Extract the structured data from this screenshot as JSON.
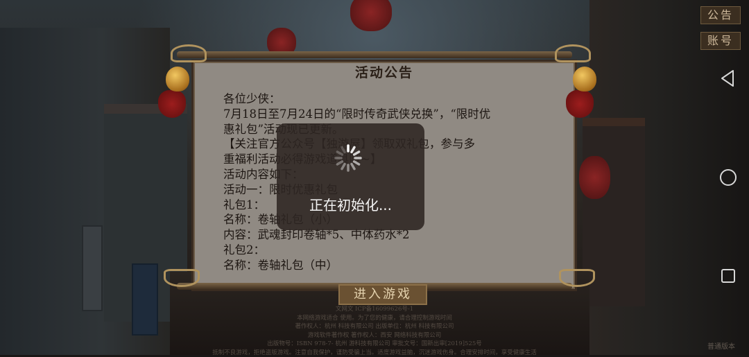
{
  "side_buttons": {
    "notice": "公告",
    "account": "账号"
  },
  "dialog": {
    "title": "活动公告",
    "lines": [
      "各位少侠：",
      "7月18日至7月24日的“限时传奇武侠兑换”，“限时优",
      "惠礼包”活动现已更新。",
      "【关注官方公众号【独游屋】领取双礼包，参与多",
      "重福利活动必得游戏道具哦~】",
      "活动内容如下：",
      "活动一：限时优惠礼包",
      "礼包1：",
      "名称：卷轴礼包（小）",
      "内容：武魂封印卷轴*5、中体药水*2",
      "礼包2：",
      "名称：卷轴礼包（中）"
    ]
  },
  "enter_button": "进入游戏",
  "loading": {
    "text": "正在初始化..."
  },
  "footer": {
    "lines": [
      "文网文 ICP备16099626号-1",
      "本网络游戏适合 使用。为了您的健康，请合理控制游戏时间",
      "著作权人：杭州 科技有限公司   出版单位：杭州 科技有限公司",
      "游戏软件著作权 著作权人：西安 网络科技有限公司",
      "出版物号：ISBN 978-7-  杭州 游科技有限公司   审批文号：国新出审[2019]525号",
      "抵制不良游戏，拒绝盗版游戏。注意自我保护，谨防受骗上当。适度游戏益脑，沉迷游戏伤身。合理安排时间，享受健康生活"
    ],
    "version": "普通版本"
  },
  "colors": {
    "dialog_bg": "#908a83",
    "accent": "#6a5132",
    "text": "#1d1612"
  }
}
